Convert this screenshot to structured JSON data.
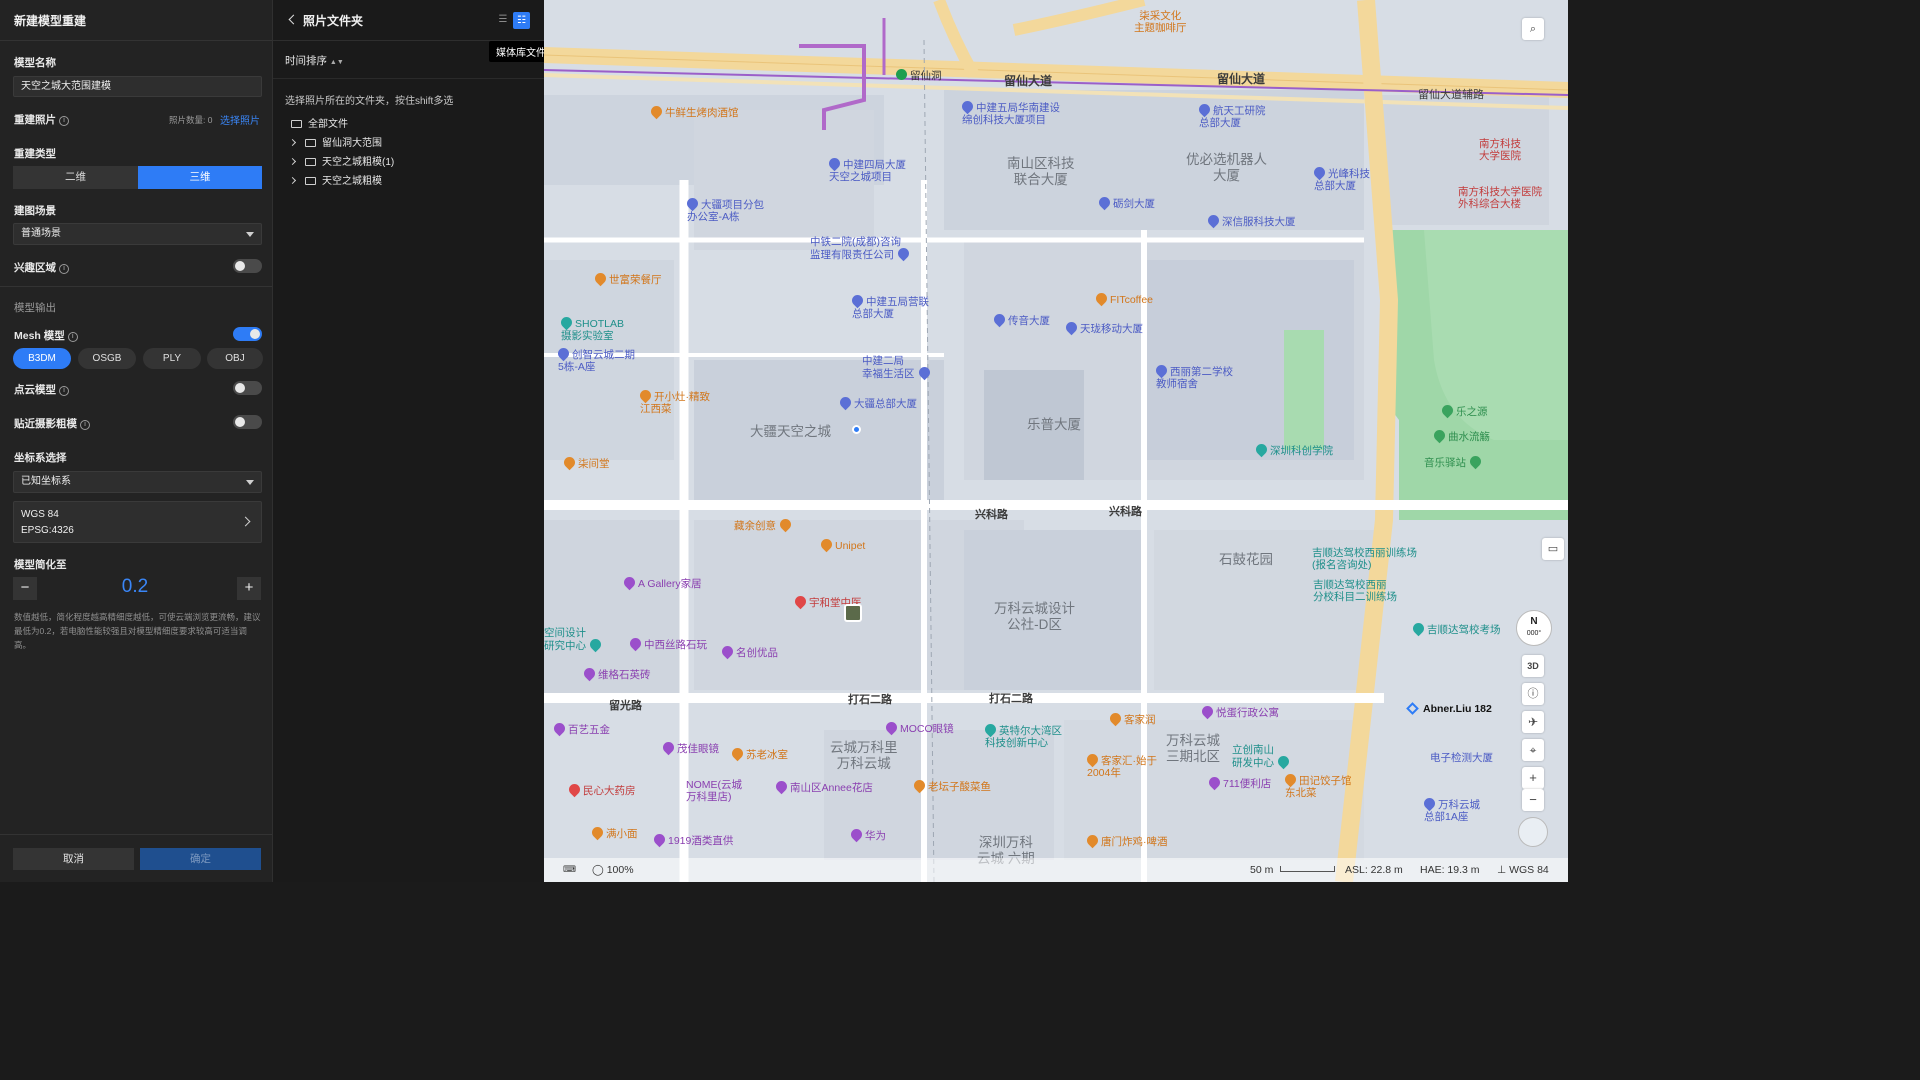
{
  "left_panel": {
    "title": "新建模型重建",
    "model_name_label": "模型名称",
    "model_name_value": "天空之城大范围建模",
    "photos_label": "重建照片",
    "photo_count": "照片数量: 0",
    "select_photos": "选择照片",
    "type_label": "重建类型",
    "type_options": [
      "二维",
      "三维"
    ],
    "type_selected": "三维",
    "scene_label": "建图场景",
    "scene_value": "普通场景",
    "roi_label": "兴趣区域",
    "roi_enabled": false,
    "output_label": "模型输出",
    "mesh_label": "Mesh 模型",
    "mesh_enabled": true,
    "formats": [
      "B3DM",
      "OSGB",
      "PLY",
      "OBJ"
    ],
    "format_selected": "B3DM",
    "pointcloud_label": "点云模型",
    "pointcloud_enabled": false,
    "near_label": "贴近摄影粗模",
    "near_enabled": false,
    "crs_label": "坐标系选择",
    "crs_value": "已知坐标系",
    "crs_name": "WGS 84",
    "crs_code": "EPSG:4326",
    "simplify_label": "模型简化至",
    "simplify_value": "0.2",
    "simplify_minus": "−",
    "simplify_plus": "+",
    "simplify_note": "数值越低，简化程度越高精细度越低，可使云端浏览更流畅，建议最低为0.2，若电脑性能较强且对模型精细度要求较高可适当调高。",
    "cancel": "取消",
    "confirm": "确定"
  },
  "mid_panel": {
    "back_icon": "chevron-left-icon",
    "title": "照片文件夹",
    "sort_label": "时间排序",
    "hint": "选择照片所在的文件夹，按住shift多选",
    "root": "全部文件",
    "folders": [
      "留仙洞大范围",
      "天空之城粗模(1)",
      "天空之城粗模"
    ]
  },
  "tooltip": "媒体库文件",
  "map": {
    "roads": [
      "留仙大道",
      "留仙大道",
      "留仙大道辅路",
      "兴科路",
      "兴科路",
      "打石二路",
      "打石二路",
      "留光路"
    ],
    "areas": [
      "南山区科技\n联合大厦",
      "优必选机器人\n大厦",
      "大疆天空之城",
      "乐普大厦",
      "石鼓花园",
      "万科云城设计\n公社-D区",
      "云城万科里\n万科云城",
      "万科云城\n三期北区",
      "深圳万科\n云城 六期"
    ],
    "station": "留仙洞",
    "pois_blue": [
      "中建五局华南建设\n绵创科技大厦项目",
      "航天工研院\n总部大厦",
      "中建四局大厦\n天空之城项目",
      "大疆项目分包\n办公室-A栋",
      "砺剑大厦",
      "光峰科技\n总部大厦",
      "深信服科技大厦",
      "中铁二院(成都)咨询\n监理有限责任公司",
      "中建五局营联\n总部大厦",
      "传音大厦",
      "天珑移动大厦",
      "创智云城二期\n5栋-A座",
      "中建二局\n幸福生活区",
      "西丽第二学校\n教师宿舍",
      "大疆总部大厦",
      "电子检测大厦",
      "万科云城\n总部1A座"
    ],
    "pois_orange": [
      "牛鲜生烤肉酒馆",
      "柒采文化\n主题咖啡厅",
      "世富荣餐厅",
      "FITcoffee",
      "开小灶·精致\n江西菜",
      "柒间堂",
      "藏余创意",
      "Unipet",
      "客家润",
      "客家汇·始于\n2004年",
      "老坛子酸菜鱼",
      "苏老冰室",
      "田记饺子馆\n东北菜",
      "满小面",
      "唐门炸鸡·啤酒"
    ],
    "pois_purple": [
      "A Gallery家居",
      "中西丝路石玩",
      "名创优品",
      "维格石英砖",
      "MOCO眼镜",
      "茂佳眼镜",
      "悦蛋行政公寓",
      "711便利店",
      "1919酒类直供",
      "华为",
      "NOME(云城\n万科里店)",
      "南山区Annee花店",
      "百艺五金"
    ],
    "pois_teal": [
      "SHOTLAB\n摄影实验室",
      "深圳科创学院",
      "英特尔大湾区\n科技创新中心",
      "立创南山\n研发中心",
      "空间设计\n研究中心",
      "吉顺达驾校西丽训练场\n(报名咨询处)",
      "吉顺达驾校西丽\n分校科目二训练场",
      "吉顺达驾校考场"
    ],
    "pois_green": [
      "乐之源",
      "曲水流觞",
      "音乐驿站"
    ],
    "pois_red": [
      "宇和堂中医",
      "民心大药房",
      "南方科技\n大学医院",
      "南方科技大学医院\n外科综合大楼"
    ],
    "user_label": "Abner.Liu 182",
    "compass": "N",
    "compass_deg": "000°",
    "btn_3d": "3D",
    "zoom_in": "+",
    "zoom_out": "−"
  },
  "status": {
    "zoom": "100%",
    "scale": "50 m",
    "asl": "ASL: 22.8 m",
    "hae": "HAE: 19.3 m",
    "crs": "WGS 84"
  }
}
